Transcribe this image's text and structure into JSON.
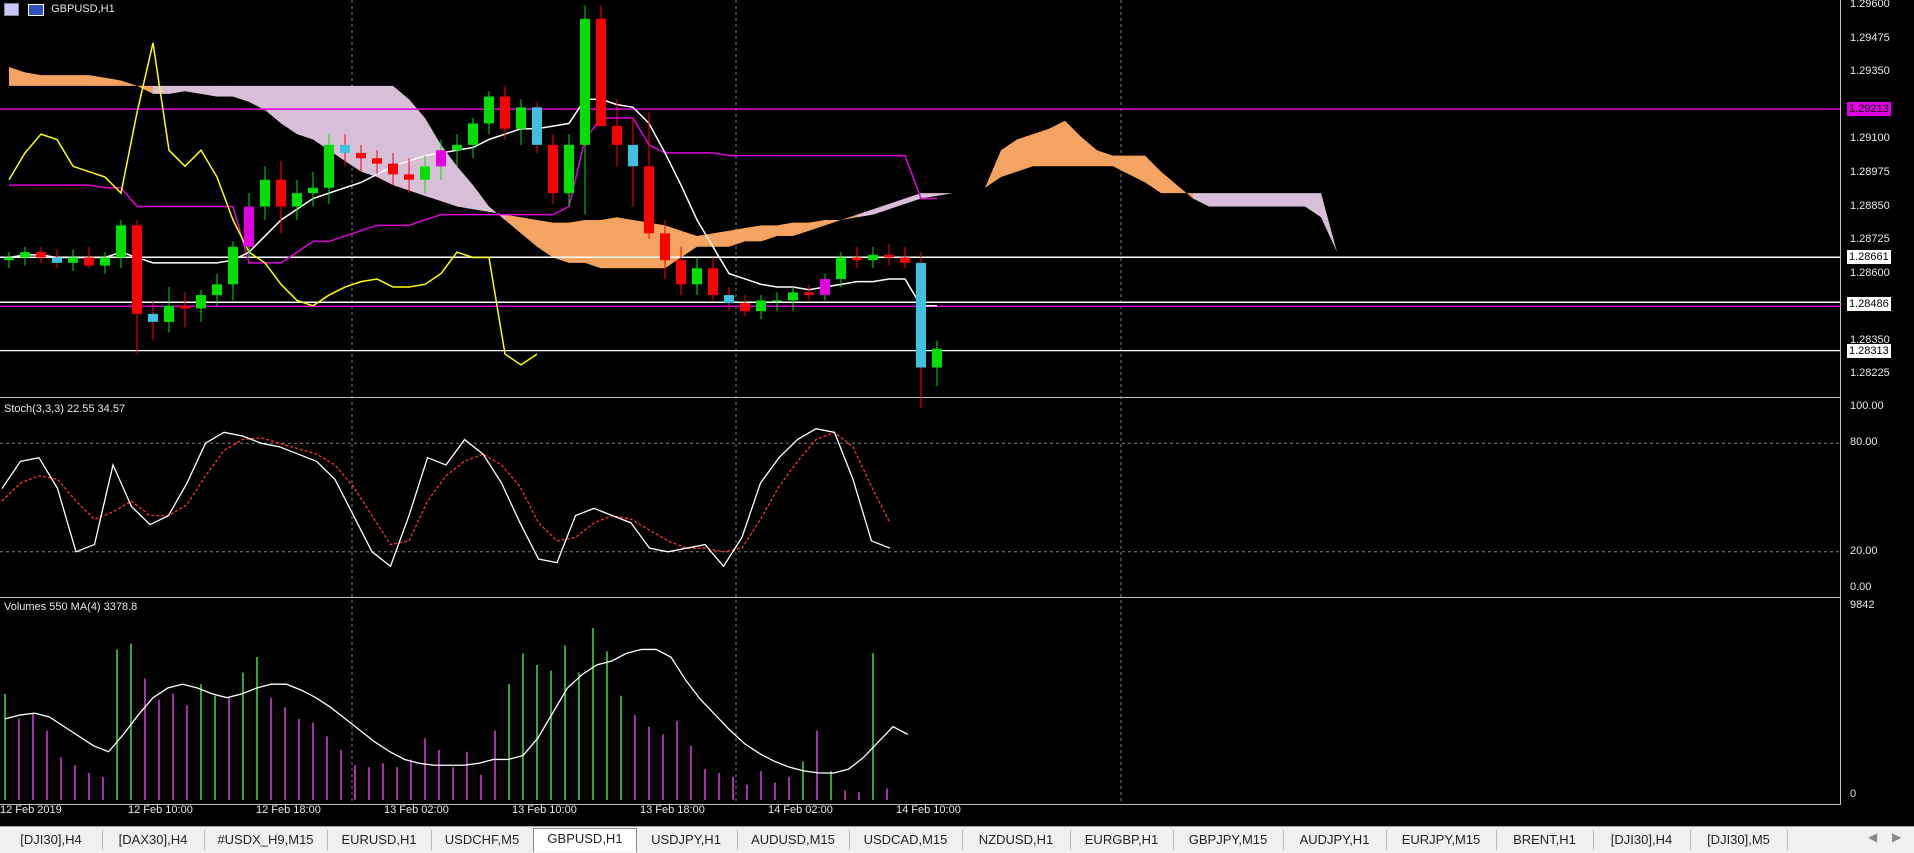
{
  "title": "GBPUSD,H1",
  "price_axis": [
    "1.29600",
    "1.29475",
    "1.29350",
    "1.29100",
    "1.28975",
    "1.28850",
    "1.28725",
    "1.28600",
    "1.28350",
    "1.28225"
  ],
  "price_marks": [
    {
      "label": "1.29213",
      "color": "#e000e0",
      "text_color": "#000"
    },
    {
      "label": "1.28661",
      "color": "#ffffff",
      "text_color": "#000"
    },
    {
      "label": "1.28486",
      "color": "#ffffff",
      "text_color": "#000"
    },
    {
      "label": "1.28313",
      "color": "#ffffff",
      "text_color": "#000"
    }
  ],
  "stoch": {
    "label": "Stoch(3,3,3) 22.55 34.57",
    "levels": [
      "100.00",
      "80.00",
      "20.00",
      "0.00"
    ]
  },
  "volumes": {
    "label": "Volumes 550 MA(4) 3378.8",
    "max": "9842",
    "min": "0"
  },
  "time_axis": [
    "12 Feb 2019",
    "12 Feb 10:00",
    "12 Feb 18:00",
    "13 Feb 02:00",
    "13 Feb 10:00",
    "13 Feb 18:00",
    "14 Feb 02:00",
    "14 Feb 10:00"
  ],
  "tabs": [
    {
      "label": "[DJI30],H4",
      "active": false
    },
    {
      "label": "[DAX30],H4",
      "active": false
    },
    {
      "label": "#USDX_H9,M15",
      "active": false
    },
    {
      "label": "EURUSD,H1",
      "active": false
    },
    {
      "label": "USDCHF,M5",
      "active": false
    },
    {
      "label": "GBPUSD,H1",
      "active": true
    },
    {
      "label": "USDJPY,H1",
      "active": false
    },
    {
      "label": "AUDUSD,M15",
      "active": false
    },
    {
      "label": "USDCAD,M15",
      "active": false
    },
    {
      "label": "NZDUSD,H1",
      "active": false
    },
    {
      "label": "EURGBP,H1",
      "active": false
    },
    {
      "label": "GBPJPY,M15",
      "active": false
    },
    {
      "label": "AUDJPY,H1",
      "active": false
    },
    {
      "label": "EURJPY,M15",
      "active": false
    },
    {
      "label": "BRENT,H1",
      "active": false
    },
    {
      "label": "[DJI30],H4",
      "active": false
    },
    {
      "label": "[DJI30],M5",
      "active": false
    }
  ],
  "candles": [
    [
      1.2865,
      1.2868,
      1.2862,
      1.2866
    ],
    [
      1.2866,
      1.287,
      1.2863,
      1.2868
    ],
    [
      1.2868,
      1.287,
      1.2864,
      1.2866
    ],
    [
      1.2866,
      1.2869,
      1.2862,
      1.2864
    ],
    [
      1.2864,
      1.2869,
      1.2861,
      1.2866
    ],
    [
      1.2866,
      1.287,
      1.2862,
      1.2863
    ],
    [
      1.2863,
      1.2868,
      1.286,
      1.2866
    ],
    [
      1.2866,
      1.288,
      1.2862,
      1.2878
    ],
    [
      1.2878,
      1.288,
      1.283,
      1.2845
    ],
    [
      1.2845,
      1.285,
      1.2835,
      1.2842
    ],
    [
      1.2842,
      1.2855,
      1.2838,
      1.2848
    ],
    [
      1.2848,
      1.2853,
      1.284,
      1.2847
    ],
    [
      1.2847,
      1.2854,
      1.2842,
      1.2852
    ],
    [
      1.2852,
      1.286,
      1.2848,
      1.2856
    ],
    [
      1.2856,
      1.2872,
      1.285,
      1.287
    ],
    [
      1.287,
      1.289,
      1.2866,
      1.2885
    ],
    [
      1.2885,
      1.29,
      1.288,
      1.2895
    ],
    [
      1.2895,
      1.2902,
      1.2875,
      1.2885
    ],
    [
      1.2885,
      1.2895,
      1.288,
      1.289
    ],
    [
      1.289,
      1.2898,
      1.2885,
      1.2892
    ],
    [
      1.2892,
      1.2912,
      1.2886,
      1.2908
    ],
    [
      1.2908,
      1.2912,
      1.29,
      1.2905
    ],
    [
      1.2905,
      1.2908,
      1.2898,
      1.2903
    ],
    [
      1.2903,
      1.2906,
      1.2897,
      1.2901
    ],
    [
      1.2901,
      1.2905,
      1.2893,
      1.2897
    ],
    [
      1.2897,
      1.2903,
      1.289,
      1.2895
    ],
    [
      1.2895,
      1.2904,
      1.289,
      1.29
    ],
    [
      1.29,
      1.291,
      1.2895,
      1.2906
    ],
    [
      1.2906,
      1.2912,
      1.29,
      1.2908
    ],
    [
      1.2908,
      1.2918,
      1.2903,
      1.2916
    ],
    [
      1.2916,
      1.2928,
      1.2912,
      1.2926
    ],
    [
      1.2926,
      1.293,
      1.291,
      1.2914
    ],
    [
      1.2914,
      1.2925,
      1.2908,
      1.2922
    ],
    [
      1.2922,
      1.2924,
      1.2905,
      1.2908
    ],
    [
      1.2908,
      1.2912,
      1.2886,
      1.289
    ],
    [
      1.289,
      1.2912,
      1.2885,
      1.2908
    ],
    [
      1.2908,
      1.296,
      1.2882,
      1.2955
    ],
    [
      1.2955,
      1.296,
      1.292,
      1.2915
    ],
    [
      1.2915,
      1.2925,
      1.29,
      1.2908
    ],
    [
      1.2908,
      1.2918,
      1.2885,
      1.29
    ],
    [
      1.29,
      1.292,
      1.2873,
      1.2875
    ],
    [
      1.2875,
      1.288,
      1.2858,
      1.2865
    ],
    [
      1.2865,
      1.287,
      1.2852,
      1.2856
    ],
    [
      1.2856,
      1.2866,
      1.2852,
      1.2862
    ],
    [
      1.2862,
      1.2866,
      1.285,
      1.2852
    ],
    [
      1.2852,
      1.2855,
      1.2846,
      1.2849
    ],
    [
      1.2849,
      1.2852,
      1.2844,
      1.2846
    ],
    [
      1.2846,
      1.2852,
      1.2843,
      1.285
    ],
    [
      1.285,
      1.2853,
      1.2846,
      1.285
    ],
    [
      1.285,
      1.2855,
      1.2846,
      1.2853
    ],
    [
      1.2853,
      1.2856,
      1.285,
      1.2852
    ],
    [
      1.2852,
      1.286,
      1.285,
      1.2858
    ],
    [
      1.2858,
      1.2868,
      1.2855,
      1.2866
    ],
    [
      1.2866,
      1.287,
      1.2862,
      1.2865
    ],
    [
      1.2865,
      1.287,
      1.2862,
      1.2867
    ],
    [
      1.2867,
      1.2871,
      1.2863,
      1.2866
    ],
    [
      1.2866,
      1.287,
      1.2862,
      1.2864
    ],
    [
      1.2864,
      1.2868,
      1.281,
      1.2825
    ],
    [
      1.2825,
      1.2835,
      1.2818,
      1.2832
    ]
  ],
  "tenkan": [
    1.2866,
    1.2867,
    1.2867,
    1.2866,
    1.2866,
    1.2866,
    1.2866,
    1.2868,
    1.2866,
    1.2864,
    1.2864,
    1.2864,
    1.2864,
    1.2864,
    1.2865,
    1.2868,
    1.2874,
    1.288,
    1.2884,
    1.2888,
    1.289,
    1.2892,
    1.2894,
    1.2897,
    1.29,
    1.2902,
    1.2904,
    1.2905,
    1.2906,
    1.2907,
    1.291,
    1.2912,
    1.2914,
    1.2914,
    1.2915,
    1.2916,
    1.2925,
    1.2925,
    1.2923,
    1.2922,
    1.2916,
    1.2905,
    1.2893,
    1.288,
    1.287,
    1.286,
    1.2858,
    1.2856,
    1.2855,
    1.2855,
    1.2854,
    1.2855,
    1.2856,
    1.2857,
    1.2857,
    1.2858,
    1.2858,
    1.2848,
    1.2848
  ],
  "kijun": [
    1.2893,
    1.2893,
    1.2893,
    1.2893,
    1.2893,
    1.2893,
    1.2892,
    1.2892,
    1.2885,
    1.2885,
    1.2885,
    1.2885,
    1.2885,
    1.2885,
    1.2885,
    1.2864,
    1.2864,
    1.2864,
    1.2868,
    1.2872,
    1.2872,
    1.2874,
    1.2876,
    1.2878,
    1.2878,
    1.2878,
    1.288,
    1.2882,
    1.2882,
    1.2882,
    1.2882,
    1.2882,
    1.2882,
    1.2882,
    1.2882,
    1.2885,
    1.291,
    1.2918,
    1.2918,
    1.2918,
    1.2908,
    1.2905,
    1.2905,
    1.2905,
    1.2905,
    1.2904,
    1.2904,
    1.2904,
    1.2904,
    1.2904,
    1.2904,
    1.2904,
    1.2904,
    1.2904,
    1.2904,
    1.2904,
    1.2904,
    1.2888,
    1.2888
  ],
  "chikou": [
    1.2895,
    1.2905,
    1.2912,
    1.291,
    1.29,
    1.2898,
    1.2896,
    1.289,
    1.292,
    1.2946,
    1.2906,
    1.29,
    1.2906,
    1.2896,
    1.288,
    1.2868,
    1.2864,
    1.2856,
    1.285,
    1.2848,
    1.2852,
    1.2855,
    1.2857,
    1.2858,
    1.2855,
    1.2855,
    1.2856,
    1.286,
    1.2868,
    1.2866,
    1.2866,
    1.283,
    1.2826,
    1.283
  ],
  "cloud_a": [
    1.2937,
    1.2935,
    1.2934,
    1.2934,
    1.2934,
    1.2934,
    1.2933,
    1.2932,
    1.293,
    1.2927,
    1.2927,
    1.2928,
    1.2927,
    1.2926,
    1.2926,
    1.2924,
    1.2921,
    1.2916,
    1.2912,
    1.291,
    1.2906,
    1.2902,
    1.2898,
    1.2896,
    1.2893,
    1.2891,
    1.2889,
    1.2887,
    1.2885,
    1.2884,
    1.2883,
    1.2882,
    1.2881,
    1.288,
    1.2879,
    1.2879,
    1.288,
    1.288,
    1.2881,
    1.288,
    1.2879,
    1.2878,
    1.2876,
    1.2874,
    1.2875,
    1.2876,
    1.2877,
    1.2878,
    1.2878,
    1.2879,
    1.2879,
    1.288,
    1.288,
    1.2881,
    1.2882,
    1.2884,
    1.2886,
    1.2888,
    1.2889,
    1.289,
    1.289,
    1.2892,
    1.2906,
    1.291,
    1.2912,
    1.2914,
    1.2917,
    1.2911,
    1.2906,
    1.2904,
    1.2904,
    1.2904,
    1.2898,
    1.2893,
    1.2888,
    1.2885,
    1.2885,
    1.2885,
    1.2885,
    1.2885,
    1.2885,
    1.2885,
    1.2881,
    1.2868
  ],
  "cloud_b": [
    1.293,
    1.293,
    1.293,
    1.293,
    1.293,
    1.293,
    1.293,
    1.293,
    1.293,
    1.293,
    1.293,
    1.293,
    1.293,
    1.293,
    1.293,
    1.293,
    1.293,
    1.293,
    1.293,
    1.293,
    1.293,
    1.293,
    1.293,
    1.293,
    1.293,
    1.2925,
    1.2918,
    1.2908,
    1.29,
    1.2893,
    1.2885,
    1.288,
    1.2875,
    1.287,
    1.2866,
    1.2864,
    1.2864,
    1.2862,
    1.2862,
    1.2862,
    1.2862,
    1.2862,
    1.2866,
    1.287,
    1.287,
    1.287,
    1.2872,
    1.2872,
    1.2874,
    1.2874,
    1.2876,
    1.2878,
    1.288,
    1.2882,
    1.2884,
    1.2886,
    1.2888,
    1.289,
    1.289,
    1.289,
    1.289,
    1.2892,
    1.2896,
    1.2898,
    1.29,
    1.29,
    1.29,
    1.29,
    1.29,
    1.29,
    1.2897,
    1.2894,
    1.289,
    1.289,
    1.289,
    1.289,
    1.289,
    1.289,
    1.289,
    1.289,
    1.289,
    1.289,
    1.289,
    1.2868
  ],
  "stoch_main": [
    55,
    70,
    72,
    55,
    20,
    24,
    68,
    45,
    35,
    40,
    58,
    80,
    86,
    84,
    80,
    78,
    74,
    70,
    60,
    40,
    20,
    12,
    40,
    72,
    68,
    82,
    74,
    58,
    36,
    16,
    14,
    40,
    44,
    40,
    36,
    22,
    20,
    22,
    24,
    12,
    28,
    58,
    72,
    82,
    88,
    86,
    60,
    26,
    22
  ],
  "stoch_signal": [
    48,
    58,
    62,
    60,
    48,
    38,
    42,
    48,
    40,
    40,
    46,
    62,
    76,
    82,
    83,
    80,
    77,
    74,
    68,
    56,
    40,
    24,
    26,
    48,
    62,
    70,
    74,
    68,
    56,
    36,
    26,
    28,
    36,
    40,
    38,
    32,
    26,
    22,
    22,
    20,
    22,
    38,
    56,
    70,
    82,
    86,
    78,
    56,
    36
  ],
  "volume_bars": [
    [
      5500,
      0
    ],
    [
      4200,
      1
    ],
    [
      4500,
      1
    ],
    [
      3600,
      1
    ],
    [
      2200,
      1
    ],
    [
      1800,
      1
    ],
    [
      1400,
      1
    ],
    [
      1200,
      1
    ],
    [
      7800,
      0
    ],
    [
      8100,
      0
    ],
    [
      6300,
      1
    ],
    [
      5200,
      1
    ],
    [
      5500,
      1
    ],
    [
      4900,
      1
    ],
    [
      6000,
      0
    ],
    [
      5400,
      0
    ],
    [
      5300,
      1
    ],
    [
      6600,
      0
    ],
    [
      7400,
      0
    ],
    [
      5300,
      1
    ],
    [
      4800,
      1
    ],
    [
      4200,
      1
    ],
    [
      4000,
      1
    ],
    [
      3300,
      1
    ],
    [
      2600,
      1
    ],
    [
      1800,
      1
    ],
    [
      1700,
      1
    ],
    [
      1900,
      1
    ],
    [
      1700,
      1
    ],
    [
      2100,
      1
    ],
    [
      3200,
      1
    ],
    [
      2600,
      1
    ],
    [
      1700,
      1
    ],
    [
      2500,
      1
    ],
    [
      1300,
      1
    ],
    [
      3600,
      1
    ],
    [
      6000,
      0
    ],
    [
      7600,
      0
    ],
    [
      7000,
      0
    ],
    [
      6700,
      0
    ],
    [
      8000,
      0
    ],
    [
      6600,
      0
    ],
    [
      8900,
      0
    ],
    [
      7700,
      0
    ],
    [
      5400,
      0
    ],
    [
      4400,
      1
    ],
    [
      3800,
      1
    ],
    [
      3400,
      1
    ],
    [
      4100,
      1
    ],
    [
      2800,
      1
    ],
    [
      1600,
      1
    ],
    [
      1400,
      1
    ],
    [
      1200,
      1
    ],
    [
      800,
      1
    ],
    [
      1500,
      1
    ],
    [
      900,
      1
    ],
    [
      1200,
      1
    ],
    [
      2000,
      0
    ],
    [
      3600,
      1
    ],
    [
      1500,
      0
    ],
    [
      500,
      1
    ],
    [
      400,
      1
    ],
    [
      7600,
      0
    ],
    [
      600,
      1
    ]
  ],
  "volume_ma": [
    4200,
    4400,
    4500,
    4300,
    3800,
    3300,
    2800,
    2500,
    3400,
    4400,
    5300,
    5800,
    6000,
    5800,
    5500,
    5300,
    5500,
    5800,
    6000,
    6000,
    5700,
    5300,
    4800,
    4200,
    3600,
    3000,
    2500,
    2100,
    1900,
    1800,
    1800,
    1800,
    1900,
    2100,
    2100,
    2300,
    3200,
    4500,
    5800,
    6500,
    7000,
    7200,
    7600,
    7800,
    7800,
    7400,
    6200,
    5200,
    4400,
    3600,
    2900,
    2400,
    2000,
    1700,
    1500,
    1400,
    1400,
    1600,
    2200,
    3000,
    3800,
    3400
  ],
  "colors": {
    "up": "#00e000",
    "down": "#ff0000",
    "bull_alt": "#e000e0",
    "bear_alt": "#40c0e0",
    "grid": "#808080",
    "cloud_bull": "#f4a460",
    "cloud_bear": "#d8bfd8",
    "tenkan": "#ffffff",
    "kijun": "#e000e0",
    "chikou": "#ffff00",
    "stoch_main": "#ffffff",
    "stoch_signal": "#ff3030",
    "vol_up": "#40e040",
    "vol_down": "#e040e0",
    "vol_ma": "#ffffff"
  }
}
